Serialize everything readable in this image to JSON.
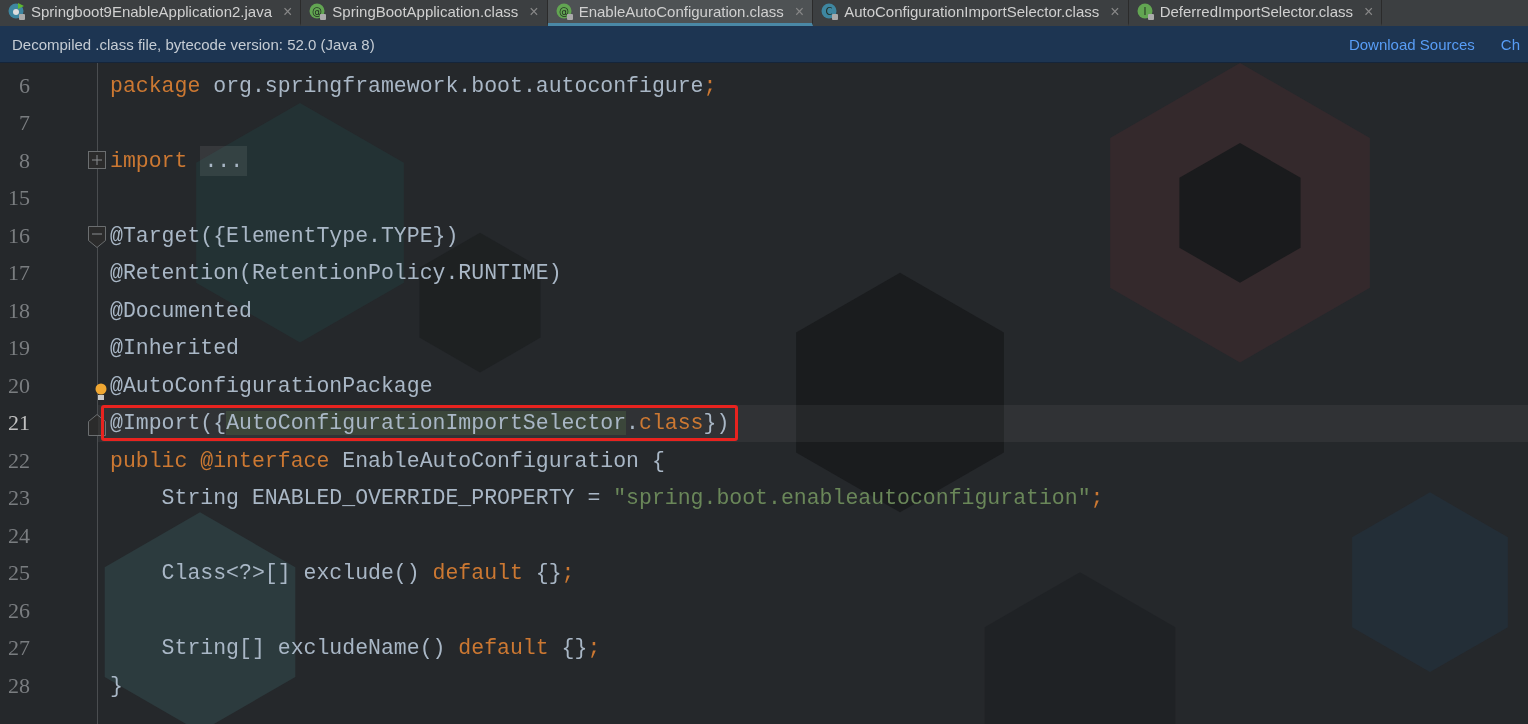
{
  "tabs": [
    {
      "label": "Springboot9EnableApplication2.java",
      "kind": "app",
      "selected": false
    },
    {
      "label": "SpringBootApplication.class",
      "kind": "annotation",
      "glyph": "@",
      "selected": false
    },
    {
      "label": "EnableAutoConfiguration.class",
      "kind": "annotation",
      "glyph": "@",
      "selected": true
    },
    {
      "label": "AutoConfigurationImportSelector.class",
      "kind": "class",
      "glyph": "C",
      "selected": false
    },
    {
      "label": "DeferredImportSelector.class",
      "kind": "interface",
      "glyph": "I",
      "selected": false
    }
  ],
  "close_glyph": "×",
  "info_bar": {
    "message": "Decompiled .class file, bytecode version: 52.0 (Java 8)",
    "links": [
      "Download Sources",
      "Ch"
    ]
  },
  "lines": [
    {
      "number": "6",
      "segments": [
        {
          "text": "package",
          "kind": "keyword"
        },
        {
          "text": " org.springframework.boot.autoconfigure",
          "kind": "plain"
        },
        {
          "text": ";",
          "kind": "keyword"
        }
      ]
    },
    {
      "number": "7"
    },
    {
      "number": "8",
      "folded": true,
      "segments": [
        {
          "text": "import",
          "kind": "keyword"
        },
        {
          "text": "...",
          "kind": "folded"
        }
      ]
    },
    {
      "number": "15"
    },
    {
      "number": "16",
      "fold_start": true,
      "segments": [
        {
          "text": "@Target({ElementType.TYPE})",
          "kind": "plain"
        }
      ]
    },
    {
      "number": "17",
      "segments": [
        {
          "text": "@Retention(RetentionPolicy.RUNTIME)",
          "kind": "plain"
        }
      ]
    },
    {
      "number": "18",
      "segments": [
        {
          "text": "@Documented",
          "kind": "plain"
        }
      ]
    },
    {
      "number": "19",
      "segments": [
        {
          "text": "@Inherited",
          "kind": "plain"
        }
      ]
    },
    {
      "number": "20",
      "bulb": true,
      "segments": [
        {
          "text": "@AutoConfigurationPackage",
          "kind": "plain"
        }
      ]
    },
    {
      "number": "21",
      "fold_end": true,
      "current": true,
      "boxed": true,
      "segments": [
        {
          "text": "@Import({",
          "kind": "plain"
        },
        {
          "text": "AutoConfigurationImportSelector",
          "kind": "match"
        },
        {
          "text": ".",
          "kind": "plain"
        },
        {
          "text": "class",
          "kind": "keyword"
        },
        {
          "text": "})",
          "kind": "plain"
        }
      ]
    },
    {
      "number": "22",
      "segments": [
        {
          "text": "public @interface",
          "kind": "keyword"
        },
        {
          "text": " EnableAutoConfiguration {",
          "kind": "plain"
        }
      ]
    },
    {
      "number": "23",
      "segments": [
        {
          "text": "    String ENABLED_OVERRIDE_PROPERTY = ",
          "kind": "plain"
        },
        {
          "text": "\"spring.boot.enableautoconfiguration\"",
          "kind": "string"
        },
        {
          "text": ";",
          "kind": "keyword"
        }
      ]
    },
    {
      "number": "24"
    },
    {
      "number": "25",
      "segments": [
        {
          "text": "    Class<?>[] exclude() ",
          "kind": "plain"
        },
        {
          "text": "default",
          "kind": "keyword"
        },
        {
          "text": " {}",
          "kind": "plain"
        },
        {
          "text": ";",
          "kind": "keyword"
        }
      ]
    },
    {
      "number": "26"
    },
    {
      "number": "27",
      "segments": [
        {
          "text": "    String[] excludeName() ",
          "kind": "plain"
        },
        {
          "text": "default",
          "kind": "keyword"
        },
        {
          "text": " {}",
          "kind": "plain"
        },
        {
          "text": ";",
          "kind": "keyword"
        }
      ]
    },
    {
      "number": "28",
      "segments": [
        {
          "text": "}",
          "kind": "plain"
        }
      ]
    }
  ]
}
